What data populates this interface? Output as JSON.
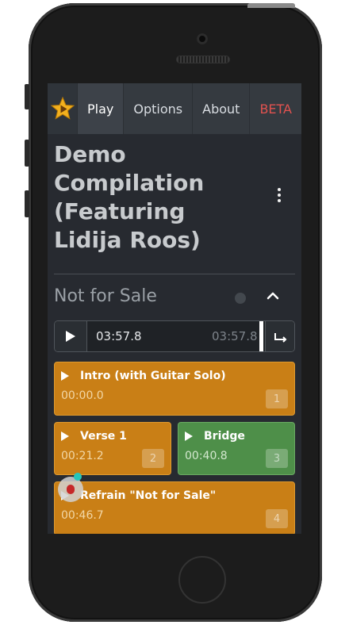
{
  "nav": {
    "items": [
      {
        "label": "Play",
        "active": true
      },
      {
        "label": "Options"
      },
      {
        "label": "About"
      },
      {
        "label": "BETA"
      }
    ]
  },
  "compilation": {
    "title": "Demo Compilation (Featuring Lidija Roos)"
  },
  "track": {
    "title": "Not for Sale"
  },
  "player": {
    "current_time": "03:57.8",
    "duration": "03:57.8"
  },
  "cues": [
    {
      "name": "Intro (with Guitar Solo)",
      "time": "00:00.0",
      "number": "1",
      "color": "#c97f16"
    },
    {
      "name": "Verse 1",
      "time": "00:21.2",
      "number": "2",
      "color": "#c97f16"
    },
    {
      "name": "Bridge",
      "time": "00:40.8",
      "number": "3",
      "color": "#4e8f49"
    },
    {
      "name": "Refrain \"Not for Sale\"",
      "time": "00:46.7",
      "number": "4",
      "color": "#c97f16"
    }
  ],
  "colors": {
    "accent_orange": "#c97f16",
    "accent_green": "#4e8f49",
    "beta_red": "#e0524f",
    "background": "#272a30"
  },
  "icons": {
    "logo": "star-play-icon",
    "menu": "vertical-ellipsis-icon",
    "collapse": "chevron-up-icon",
    "play": "play-icon",
    "loop": "loop-to-start-icon",
    "debug": "ladybug-icon"
  }
}
